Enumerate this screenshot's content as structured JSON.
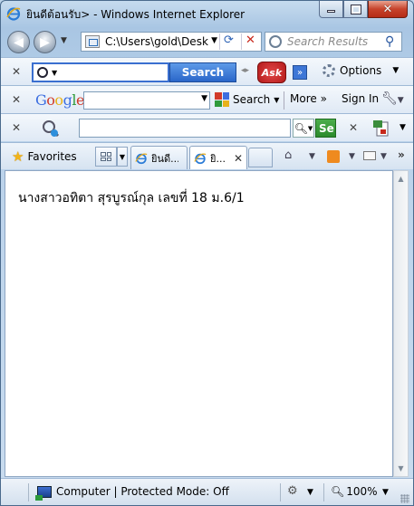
{
  "window": {
    "title": "ยินดีต้อนรับ> - Windows Internet Explorer"
  },
  "address_bar": {
    "url": "C:\\Users\\gold\\Desk",
    "search_placeholder": "Search Results"
  },
  "ask_toolbar": {
    "search_label": "Search",
    "logo_text": "Ask",
    "more_label": "»",
    "options_label": "Options"
  },
  "google_toolbar": {
    "logo": [
      "G",
      "o",
      "o",
      "g",
      "l",
      "e"
    ],
    "logo_colors": [
      "#3c6ee0",
      "#d13b2a",
      "#e8b21a",
      "#3c6ee0",
      "#2f9a3b",
      "#d13b2a"
    ],
    "search_label": "Search",
    "more_label": "More »",
    "signin_label": "Sign In"
  },
  "third_toolbar": {
    "go_label": "Se"
  },
  "tabs_bar": {
    "favorites_label": "Favorites",
    "tabs": [
      {
        "label": "ยินดี..."
      },
      {
        "label": "ยิ..."
      }
    ]
  },
  "content": {
    "text": "นางสาวอทิตา สุรบูรณ์กุล เลขที่ 18 ม.6/1"
  },
  "status_bar": {
    "zone_text": "Computer | Protected Mode: Off",
    "zoom": "100%"
  },
  "colors": {
    "close_button": "#c7432b",
    "ask_blue": "#2a66c9",
    "ask_red": "#b51b1b",
    "go_green": "#2b8a2b"
  }
}
